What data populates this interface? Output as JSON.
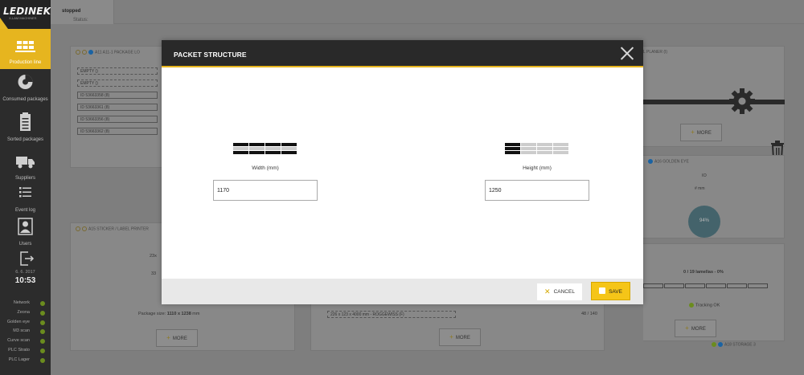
{
  "app": {
    "logo_text": "LEDINEK",
    "logo_sub": "X-LAM MACHINES",
    "brand_color": "#e6b51f"
  },
  "topbar": {
    "status_prefix": "Status:",
    "status_value": "stopped"
  },
  "sidebar": {
    "items": [
      {
        "label": "Production line",
        "icon": "conveyor-icon",
        "active": true
      },
      {
        "label": "Consumed packages",
        "icon": "consumed-icon"
      },
      {
        "label": "Sorted packages",
        "icon": "clipboard-icon"
      },
      {
        "label": "Suppliers",
        "icon": "truck-icon"
      },
      {
        "label": "Event log",
        "icon": "list-icon"
      },
      {
        "label": "Users",
        "icon": "user-icon"
      },
      {
        "label": "",
        "icon": "logout-icon"
      }
    ],
    "date": "6. 6. 2017",
    "time": "10:53",
    "statuses": [
      "Network",
      "Zeona",
      "Golden eye",
      "M3 scan",
      "Curve scan",
      "PLC Strato",
      "PLC Lager"
    ]
  },
  "background": {
    "panel1_title": "A11 A11-1 PACKAGE LO",
    "panel1_rows": [
      "EMPTY ()",
      "EMPTY ()",
      "ID 53663358 (8)",
      "ID 53663361 (8)",
      "ID 53663356 (8)",
      "ID 53663362 (8)"
    ],
    "panel2_title": "A15 STICKER / LABEL PRINTER",
    "panel2_vals": [
      "23x",
      "33"
    ],
    "package_size_prefix": "Package size:",
    "package_size_value": "1110 x 1238",
    "package_size_unit": "mm",
    "planer_title": "L PLANER (I)",
    "golden_eye_title": "A16 GOLDEN EYE",
    "golden_eye_io": "IO",
    "golden_eye_unit": "# mm",
    "gauge_value": "94%",
    "lamellas_text": "0 / 19 lamellas - 0%",
    "tracking_text": "Tracking OK",
    "storage_title": "A18 STORAGE 3",
    "center_box_text": "226 x 123 x 4000 mm - ROGGEWISS (F)",
    "center_count": "48 / 140",
    "more_label": "MORE"
  },
  "modal": {
    "title": "PACKET STRUCTURE",
    "width_label": "Width (mm)",
    "width_value": "1170",
    "height_label": "Height (mm)",
    "height_value": "1250",
    "cancel_label": "CANCEL",
    "save_label": "SAVE"
  }
}
